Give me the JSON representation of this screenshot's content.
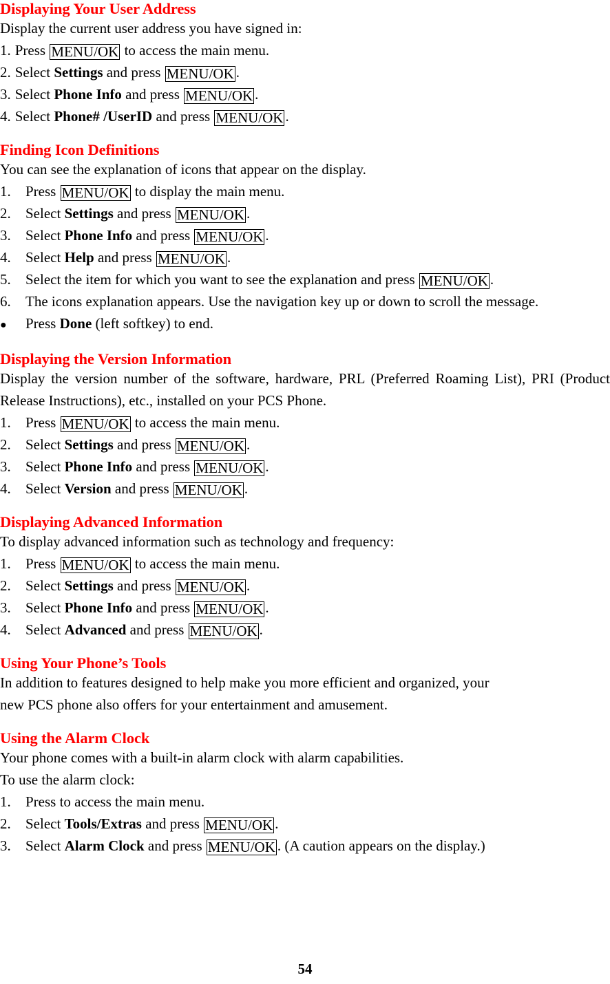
{
  "document": {
    "page_number": "54",
    "heading_color": "#ff0000",
    "key_label": "MENU/OK"
  },
  "sections": [
    {
      "id": "user-address",
      "heading": "Displaying Your User Address",
      "intro": "Display the current user address you have signed in:",
      "steps": [
        {
          "marker": "1.",
          "pre": "Press ",
          "key": "MENU/OK",
          "post": " to access the main menu."
        },
        {
          "marker": "2.",
          "pre": "Select ",
          "bold": "Settings",
          "mid": " and press ",
          "key": "MENU/OK",
          "post": "."
        },
        {
          "marker": "3.",
          "pre": "Select ",
          "bold": "Phone Info",
          "mid": " and press ",
          "key": "MENU/OK",
          "post": "."
        },
        {
          "marker": "4.",
          "pre": "Select ",
          "bold": "Phone# /UserID",
          "mid": " and press ",
          "key": "MENU/OK",
          "post": "."
        }
      ]
    },
    {
      "id": "icon-definitions",
      "heading": "Finding Icon Definitions",
      "intro": "You can see the explanation of icons that appear on the display.",
      "steps": [
        {
          "marker": "1.",
          "pre": "Press ",
          "key": "MENU/OK",
          "post": " to display the main menu."
        },
        {
          "marker": "2.",
          "pre": "Select ",
          "bold": "Settings",
          "mid": " and press ",
          "key": "MENU/OK",
          "post": "."
        },
        {
          "marker": "3.",
          "pre": "Select ",
          "bold": "Phone Info",
          "mid": " and press ",
          "key": "MENU/OK",
          "post": "."
        },
        {
          "marker": "4.",
          "pre": "Select ",
          "bold": "Help",
          "mid": " and press ",
          "key": "MENU/OK",
          "post": "."
        },
        {
          "marker": "5.",
          "pre": "Select the item for which you want to see the explanation and press ",
          "key": "MENU/OK",
          "post": "."
        },
        {
          "marker": "6.",
          "pre": "The icons explanation appears. Use the navigation key up or down to scroll the message."
        },
        {
          "marker": "●",
          "pre": " Press ",
          "bold": "Done",
          "mid": " (left softkey) to end."
        }
      ]
    },
    {
      "id": "version-information",
      "heading": "Displaying the Version Information",
      "intro": "Display the version number of the software, hardware, PRL (Preferred Roaming List), PRI (Product Release Instructions), etc., installed on your PCS Phone.",
      "steps": [
        {
          "marker": "1.",
          "pre": "Press ",
          "key": "MENU/OK",
          "post": " to access the main menu."
        },
        {
          "marker": "2.",
          "pre": "Select ",
          "bold": "Settings",
          "mid": " and press ",
          "key": "MENU/OK",
          "post": "."
        },
        {
          "marker": "3.",
          "pre": "Select ",
          "bold": "Phone Info",
          "mid": " and press ",
          "key": "MENU/OK",
          "post": "."
        },
        {
          "marker": "4.",
          "pre": "Select ",
          "bold": "Version",
          "mid": " and press ",
          "key": "MENU/OK",
          "post": "."
        }
      ]
    },
    {
      "id": "advanced-information",
      "heading": "Displaying Advanced Information",
      "intro": "To display advanced information such as technology and frequency:",
      "steps": [
        {
          "marker": "1.",
          "pre": "Press ",
          "key": "MENU/OK",
          "post": " to access the main menu."
        },
        {
          "marker": "2.",
          "pre": "Select ",
          "bold": "Settings",
          "mid": " and press ",
          "key": "MENU/OK",
          "post": "."
        },
        {
          "marker": "3.",
          "pre": "Select ",
          "bold": "Phone Info",
          "mid": " and press ",
          "key": "MENU/OK",
          "post": "."
        },
        {
          "marker": "4.",
          "pre": "Select ",
          "bold": "Advanced",
          "mid": " and press ",
          "key": "MENU/OK",
          "post": "."
        }
      ]
    },
    {
      "id": "phone-tools",
      "heading": "Using Your Phone’s Tools",
      "intro_line1": "In addition to features designed to help make you more efficient and organized, your",
      "intro_line2": "new PCS phone also offers for your entertainment and amusement."
    },
    {
      "id": "alarm-clock",
      "heading": "Using the Alarm Clock",
      "intro_line1": "Your phone comes with a built-in alarm clock with alarm capabilities.",
      "intro_line2": "To use the alarm clock:",
      "steps": [
        {
          "marker": "1.",
          "pre": "Press to access the main menu."
        },
        {
          "marker": "2.",
          "pre": "Select ",
          "bold": "Tools/Extras",
          "mid": " and press ",
          "key": "MENU/OK",
          "post": "."
        },
        {
          "marker": "3.",
          "pre": "Select ",
          "bold": "Alarm Clock",
          "mid": " and press ",
          "key": "MENU/OK",
          "post": ". (A caution appears on the display.)"
        }
      ]
    }
  ]
}
